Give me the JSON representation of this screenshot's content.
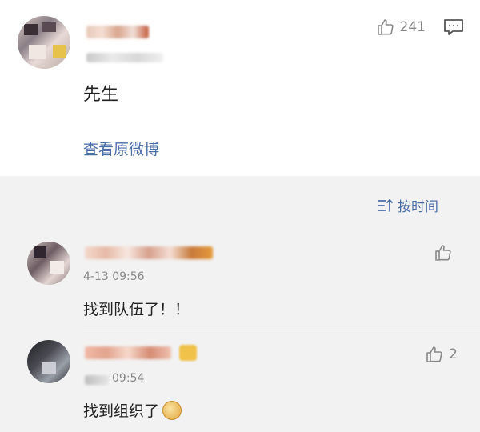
{
  "post": {
    "like_count": "241",
    "text": "先生",
    "view_original": "查看原微博"
  },
  "sort": {
    "label": "按时间"
  },
  "comments": [
    {
      "time": "4-13 09:56",
      "text": "找到队伍了！！",
      "likes": ""
    },
    {
      "time": "09:54",
      "text": "找到组织了",
      "likes": "2"
    }
  ],
  "colors": {
    "link": "#4a6ea8",
    "muted": "#888888",
    "background": "#f2f2f2"
  }
}
